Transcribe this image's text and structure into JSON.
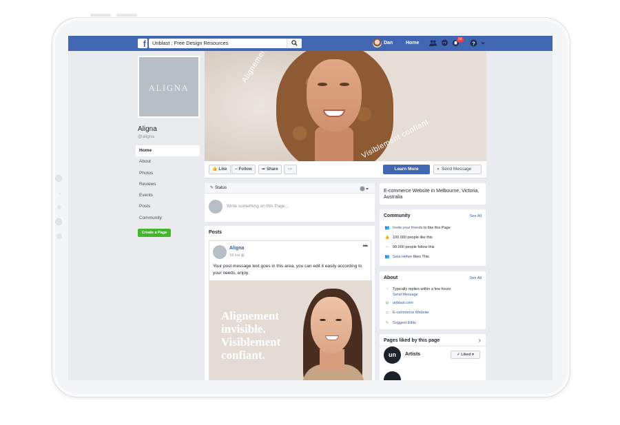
{
  "topbar": {
    "search_value": "Unblast : Free Design Resources",
    "user_name": "Dan",
    "home_label": "Home",
    "notification_count": "14"
  },
  "page": {
    "logo_text": "ALIGNA",
    "name": "Aligna",
    "handle": "@aligna",
    "create_page_label": "Create a Page"
  },
  "left_nav": [
    "Home",
    "About",
    "Photos",
    "Reviews",
    "Events",
    "Posts",
    "Community"
  ],
  "cover": {
    "text_top": "Alignement invisible",
    "text_bottom": "Visiblement confiant"
  },
  "actions": {
    "like": "Like",
    "follow": "Follow",
    "share": "Share",
    "more": "···",
    "learn_more": "Learn More",
    "send_message": "Send Message"
  },
  "status": {
    "label": "Status",
    "placeholder": "Write something on this Page..."
  },
  "posts": {
    "title": "Posts",
    "author": "Aligna",
    "time": "18 hrs",
    "text": "Your post message text goes in this area, you can edit it easily according to your needs, enjoy.",
    "image_text": "Alignement invisible. Visiblement confiant."
  },
  "description": "E-commerce Website in Melbourne, Victoria, Australia",
  "community": {
    "title": "Community",
    "see_all": "See All",
    "invite_link": "Invite your friends",
    "invite_rest": "to like this Page",
    "likes": "100.000 people like this",
    "follows": "99.000 people follow this",
    "friend_link": "Sara Helwe",
    "friend_rest": "likes This"
  },
  "about": {
    "title": "About",
    "see_all": "See All",
    "replies": "Typically replies within a few hours",
    "send_message": "Send Message",
    "website": "unblast.com",
    "category": "E-commerce Website",
    "suggest": "Suggest Edits"
  },
  "pages_liked": {
    "title": "Pages liked by this page",
    "artist": "Artists",
    "artist_logo": "un",
    "liked": "Liked"
  },
  "colors": {
    "facebook_blue": "#4267b2",
    "green": "#42b72a",
    "link": "#365899",
    "background": "#e9ebee"
  }
}
